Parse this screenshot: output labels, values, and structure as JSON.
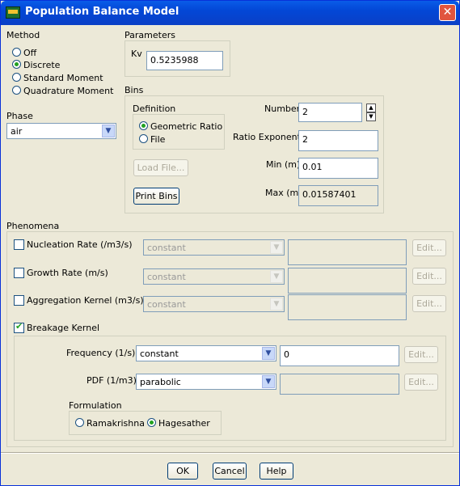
{
  "window": {
    "title": "Population Balance Model"
  },
  "method": {
    "label": "Method",
    "options": [
      {
        "label": "Off",
        "selected": false
      },
      {
        "label": "Discrete",
        "selected": true
      },
      {
        "label": "Standard Moment",
        "selected": false
      },
      {
        "label": "Quadrature Moment",
        "selected": false
      }
    ]
  },
  "parameters": {
    "label": "Parameters",
    "kv_label": "Kv",
    "kv_value": "0.5235988"
  },
  "phase": {
    "label": "Phase",
    "value": "air"
  },
  "bins": {
    "label": "Bins",
    "definition_label": "Definition",
    "definition_options": [
      {
        "label": "Geometric Ratio",
        "selected": true
      },
      {
        "label": "File",
        "selected": false
      }
    ],
    "number_label": "Number",
    "number_value": "2",
    "ratio_exponent_label": "Ratio Exponent",
    "ratio_exponent_value": "2",
    "min_label": "Min (m)",
    "min_value": "0.01",
    "max_label": "Max (m)",
    "max_value": "0.01587401",
    "load_file_label": "Load File...",
    "print_bins_label": "Print Bins"
  },
  "phenomena": {
    "label": "Phenomena",
    "nucleation": {
      "label": "Nucleation Rate (/m3/s)",
      "checked": false,
      "method": "constant",
      "value": "",
      "edit": "Edit..."
    },
    "growth": {
      "label": "Growth Rate (m/s)",
      "checked": false,
      "method": "constant",
      "value": "",
      "edit": "Edit..."
    },
    "aggregation": {
      "label": "Aggregation Kernel (m3/s)",
      "checked": false,
      "method": "constant",
      "value": "",
      "edit": "Edit..."
    },
    "breakage": {
      "label": "Breakage Kernel",
      "checked": true,
      "frequency_label": "Frequency (1/s)",
      "frequency_method": "constant",
      "frequency_value": "0",
      "frequency_edit": "Edit...",
      "pdf_label": "PDF (1/m3)",
      "pdf_method": "parabolic",
      "pdf_value": "",
      "pdf_edit": "Edit...",
      "formulation_label": "Formulation",
      "formulation_options": [
        {
          "label": "Ramakrishna",
          "selected": false
        },
        {
          "label": "Hagesather",
          "selected": true
        }
      ]
    }
  },
  "footer": {
    "ok": "OK",
    "cancel": "Cancel",
    "help": "Help"
  }
}
